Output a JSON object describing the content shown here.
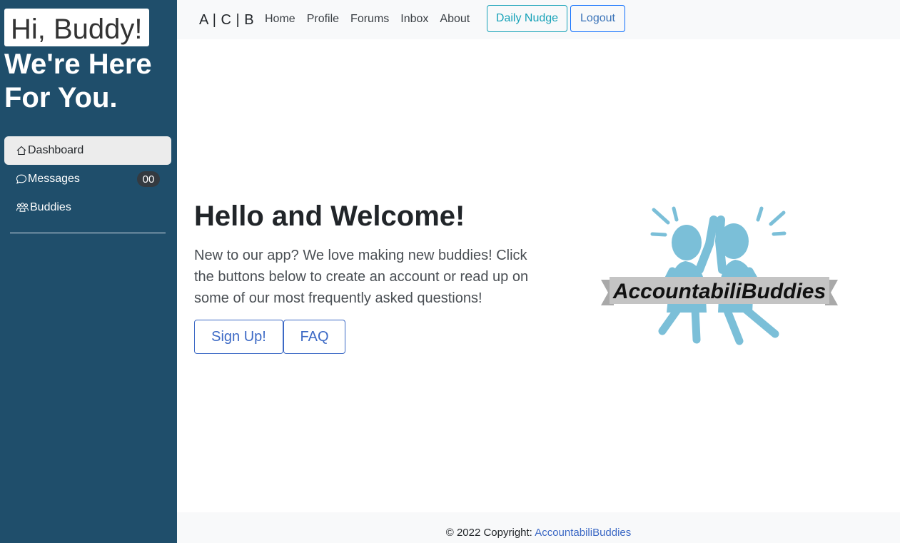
{
  "sidebar": {
    "greeting": "Hi, Buddy!",
    "tagline": "We're Here For You.",
    "items": [
      {
        "label": "Dashboard",
        "icon": "home-icon",
        "active": true
      },
      {
        "label": "Messages",
        "icon": "chat-icon",
        "badge": "00"
      },
      {
        "label": "Buddies",
        "icon": "people-icon"
      }
    ]
  },
  "topnav": {
    "brand": "A | C | B",
    "links": [
      "Home",
      "Profile",
      "Forums",
      "Inbox",
      "About"
    ],
    "nudge_label": "Daily Nudge",
    "logout_label": "Logout"
  },
  "hero": {
    "title": "Hello and Welcome!",
    "text": "New to our app? We love making new buddies! Click the buttons below to create an account or read up on some of our most frequently asked questions!",
    "signup_label": "Sign Up!",
    "faq_label": "FAQ"
  },
  "logo": {
    "text": "AccountabiliBuddies",
    "figure_color": "#7bbfd8",
    "banner_color": "#c4c4c4"
  },
  "footer": {
    "prefix": "© 2022 Copyright: ",
    "link": "AccountabiliBuddies"
  },
  "colors": {
    "sidebar_bg": "#1f4e6b",
    "accent_info": "#17a2b8",
    "accent_primary": "#3c69c5"
  }
}
